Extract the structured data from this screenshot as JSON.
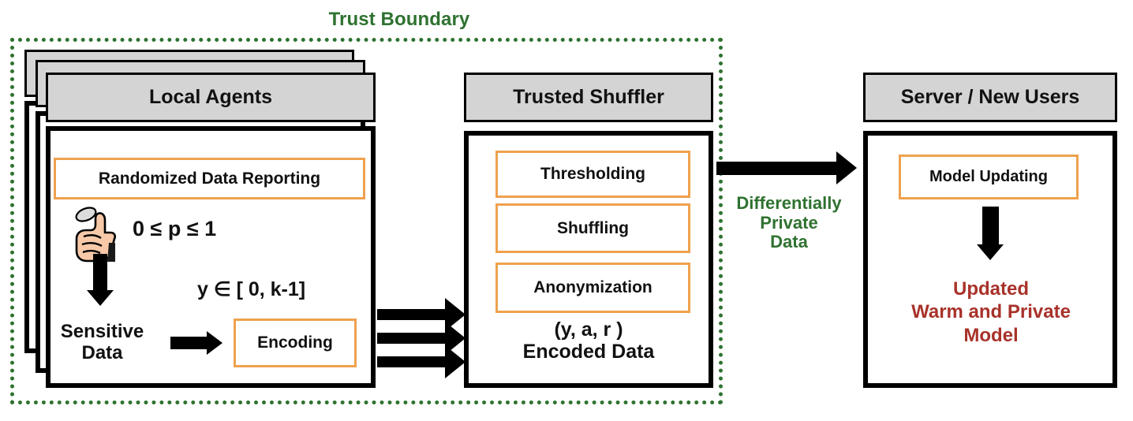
{
  "colors": {
    "green": "#2F7230",
    "orange": "#EFA14E",
    "red": "#A8322A",
    "grey_header": "#D4D4D4",
    "black": "#000000"
  },
  "trust_boundary": {
    "label": "Trust Boundary"
  },
  "local_agents": {
    "header": "Local Agents",
    "randomized_data_reporting": "Randomized Data Reporting",
    "probability_expression": "0 ≤  p ≤ 1",
    "sensitive_data": "Sensitive\nData",
    "sensitive_data_line1": "Sensitive",
    "sensitive_data_line2": "Data",
    "encoding_range": "y ∈ [ 0, k-1]",
    "encoding": "Encoding",
    "coin_icon": "thumb-coin-flip-icon",
    "stack_count": 3
  },
  "trusted_shuffler": {
    "header": "Trusted Shuffler",
    "steps": [
      "Thresholding",
      "Shuffling",
      "Anonymization"
    ],
    "encoded_tuple": "(y, a, r )",
    "encoded_caption": "Encoded Data",
    "input_arrow_count": 3
  },
  "transfer": {
    "label_line1": "Differentially",
    "label_line2": "Private",
    "label_line3": "Data",
    "arrow": "right-arrow-icon"
  },
  "server": {
    "header": "Server / New Users",
    "model_updating": "Model Updating",
    "result_line1": "Updated",
    "result_line2": "Warm and Private",
    "result_line3": "Model",
    "arrow": "down-arrow-icon"
  }
}
